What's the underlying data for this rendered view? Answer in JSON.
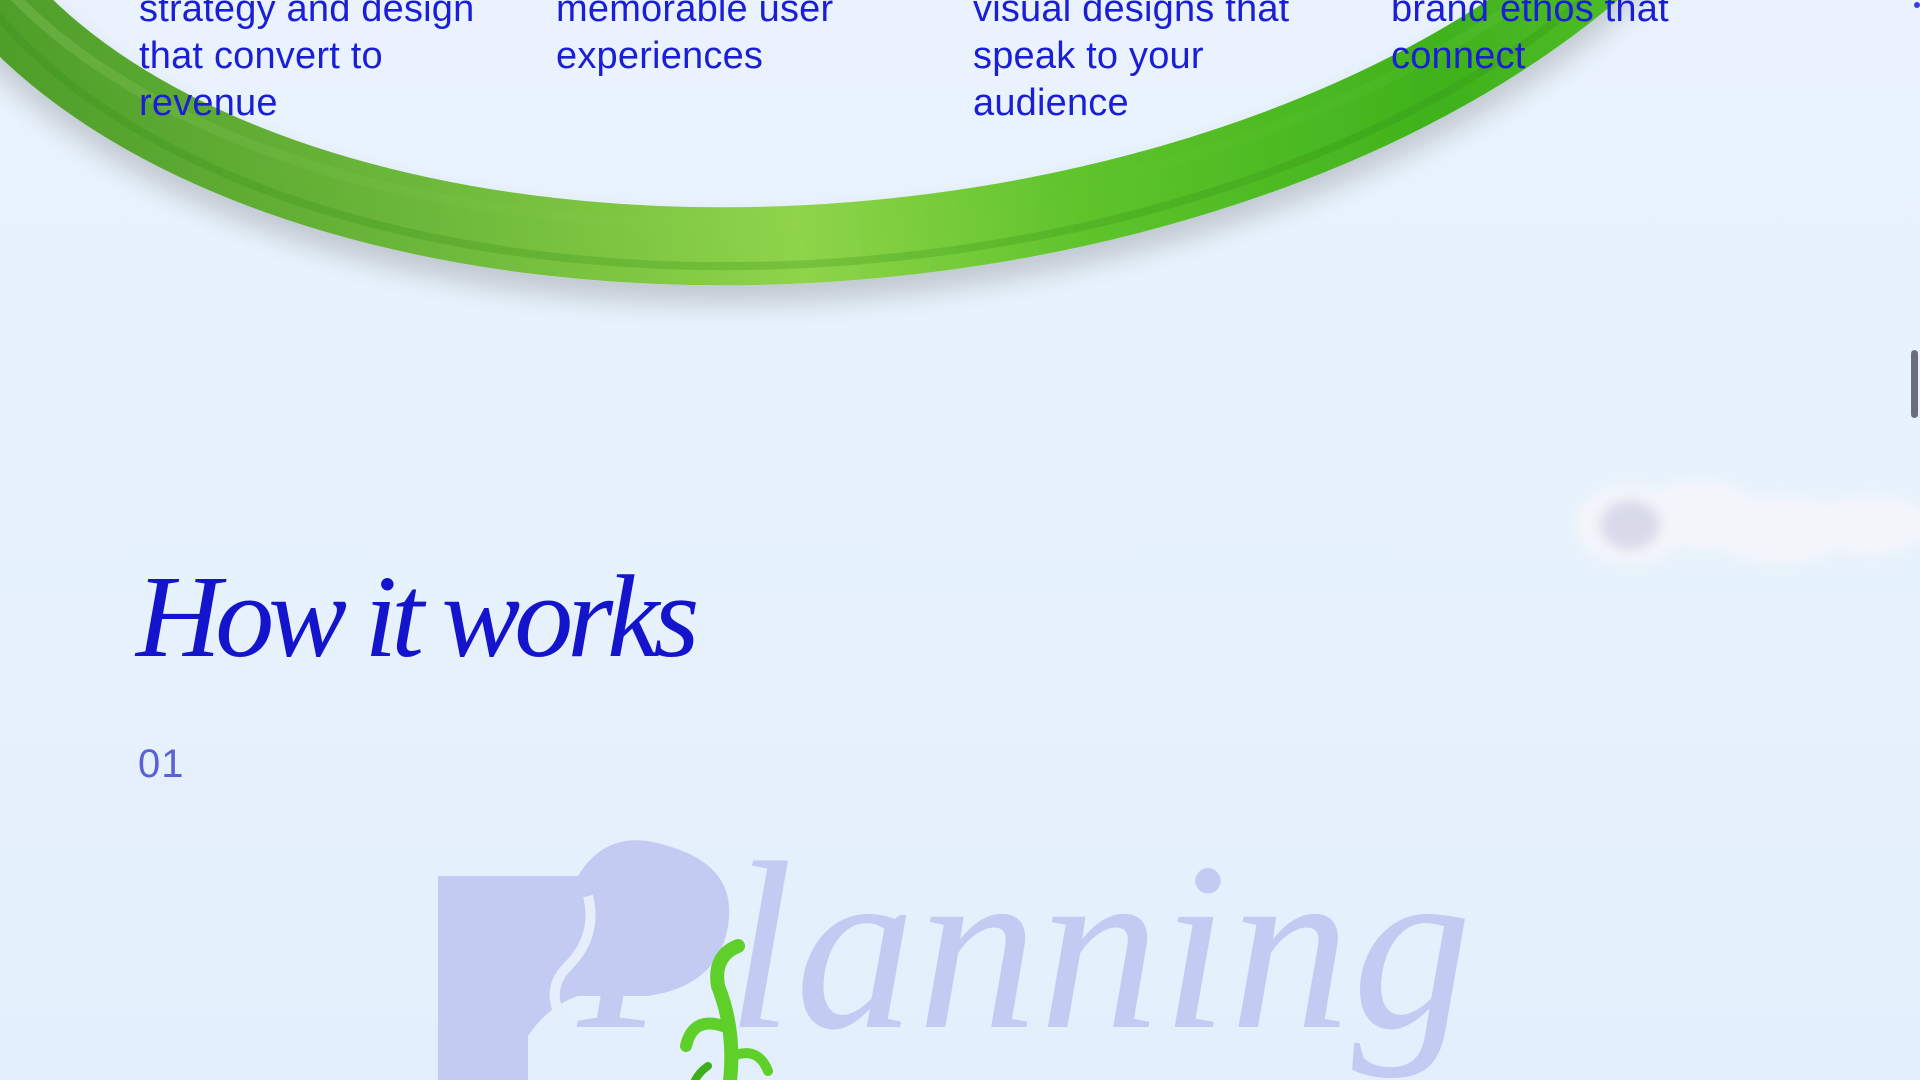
{
  "services": [
    {
      "text": "strategy and design\nthat convert to\nrevenue"
    },
    {
      "text": "memorable user\nexperiences"
    },
    {
      "text": "visual designs that\nspeak to your\naudience"
    },
    {
      "text": "brand ethos that\nconnect"
    }
  ],
  "how_it_works": {
    "title": "How it works",
    "step_number": "01",
    "step_word": "Planning"
  },
  "colors": {
    "background": "#e8f2fc",
    "accent_blue": "#1414cc",
    "step_number": "#5a61d6",
    "planning_word": "#c3cbf3",
    "ring_green": "#4fc52a"
  },
  "icons": {
    "ring": "green-ring-illustration",
    "cloud": "cloud-illustration",
    "sprout": "sprout-illustration"
  }
}
